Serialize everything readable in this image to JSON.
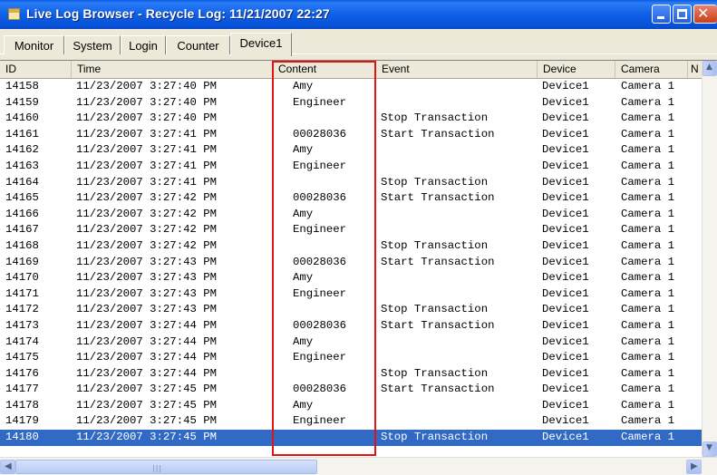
{
  "window": {
    "title": "Live Log Browser - Recycle Log: 11/21/2007 22:27",
    "controls": [
      "minimize",
      "maximize",
      "close"
    ]
  },
  "tabs": [
    {
      "label": "Monitor",
      "active": false
    },
    {
      "label": "System",
      "active": false
    },
    {
      "label": "Login",
      "active": false
    },
    {
      "label": "Counter",
      "active": false
    },
    {
      "label": "Device1",
      "active": true
    }
  ],
  "table": {
    "columns": [
      "ID",
      "Time",
      "Content",
      "Event",
      "Device",
      "Camera",
      "N"
    ],
    "rows": [
      [
        "14158",
        "11/23/2007 3:27:40 PM",
        "Amy",
        "",
        "Device1",
        "Camera 1"
      ],
      [
        "14159",
        "11/23/2007 3:27:40 PM",
        "Engineer",
        "",
        "Device1",
        "Camera 1"
      ],
      [
        "14160",
        "11/23/2007 3:27:40 PM",
        "",
        "Stop Transaction",
        "Device1",
        "Camera 1"
      ],
      [
        "14161",
        "11/23/2007 3:27:41 PM",
        "00028036",
        "Start Transaction",
        "Device1",
        "Camera 1"
      ],
      [
        "14162",
        "11/23/2007 3:27:41 PM",
        "Amy",
        "",
        "Device1",
        "Camera 1"
      ],
      [
        "14163",
        "11/23/2007 3:27:41 PM",
        "Engineer",
        "",
        "Device1",
        "Camera 1"
      ],
      [
        "14164",
        "11/23/2007 3:27:41 PM",
        "",
        "Stop Transaction",
        "Device1",
        "Camera 1"
      ],
      [
        "14165",
        "11/23/2007 3:27:42 PM",
        "00028036",
        "Start Transaction",
        "Device1",
        "Camera 1"
      ],
      [
        "14166",
        "11/23/2007 3:27:42 PM",
        "Amy",
        "",
        "Device1",
        "Camera 1"
      ],
      [
        "14167",
        "11/23/2007 3:27:42 PM",
        "Engineer",
        "",
        "Device1",
        "Camera 1"
      ],
      [
        "14168",
        "11/23/2007 3:27:42 PM",
        "",
        "Stop Transaction",
        "Device1",
        "Camera 1"
      ],
      [
        "14169",
        "11/23/2007 3:27:43 PM",
        "00028036",
        "Start Transaction",
        "Device1",
        "Camera 1"
      ],
      [
        "14170",
        "11/23/2007 3:27:43 PM",
        "Amy",
        "",
        "Device1",
        "Camera 1"
      ],
      [
        "14171",
        "11/23/2007 3:27:43 PM",
        "Engineer",
        "",
        "Device1",
        "Camera 1"
      ],
      [
        "14172",
        "11/23/2007 3:27:43 PM",
        "",
        "Stop Transaction",
        "Device1",
        "Camera 1"
      ],
      [
        "14173",
        "11/23/2007 3:27:44 PM",
        "00028036",
        "Start Transaction",
        "Device1",
        "Camera 1"
      ],
      [
        "14174",
        "11/23/2007 3:27:44 PM",
        "Amy",
        "",
        "Device1",
        "Camera 1"
      ],
      [
        "14175",
        "11/23/2007 3:27:44 PM",
        "Engineer",
        "",
        "Device1",
        "Camera 1"
      ],
      [
        "14176",
        "11/23/2007 3:27:44 PM",
        "",
        "Stop Transaction",
        "Device1",
        "Camera 1"
      ],
      [
        "14177",
        "11/23/2007 3:27:45 PM",
        "00028036",
        "Start Transaction",
        "Device1",
        "Camera 1"
      ],
      [
        "14178",
        "11/23/2007 3:27:45 PM",
        "Amy",
        "",
        "Device1",
        "Camera 1"
      ],
      [
        "14179",
        "11/23/2007 3:27:45 PM",
        "Engineer",
        "",
        "Device1",
        "Camera 1"
      ],
      [
        "14180",
        "11/23/2007 3:27:45 PM",
        "",
        "Stop Transaction",
        "Device1",
        "Camera 1"
      ]
    ],
    "selected_row_id": "14180",
    "highlighted_column": "Content"
  },
  "colors": {
    "titlebar": "#0f5fe6",
    "selection": "#316ac5",
    "highlight_box": "#e11414"
  },
  "icons": {
    "app": "log-browser-icon",
    "scroll_left": "arrow-left-icon",
    "scroll_right": "arrow-right-icon"
  }
}
